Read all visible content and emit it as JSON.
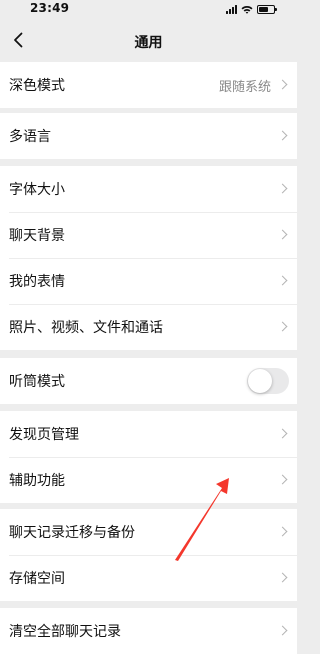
{
  "status_bar": {
    "time": "23:49"
  },
  "header": {
    "title": "通用"
  },
  "groups": [
    {
      "items": [
        {
          "label": "深色模式",
          "value": "跟随系统"
        }
      ]
    },
    {
      "items": [
        {
          "label": "多语言"
        }
      ]
    },
    {
      "items": [
        {
          "label": "字体大小"
        },
        {
          "label": "聊天背景"
        },
        {
          "label": "我的表情"
        },
        {
          "label": "照片、视频、文件和通话"
        }
      ]
    },
    {
      "items": [
        {
          "label": "听筒模式",
          "toggle_on": false
        }
      ]
    },
    {
      "items": [
        {
          "label": "发现页管理"
        },
        {
          "label": "辅助功能"
        }
      ]
    },
    {
      "items": [
        {
          "label": "聊天记录迁移与备份"
        },
        {
          "label": "存储空间"
        }
      ]
    },
    {
      "items": [
        {
          "label": "清空全部聊天记录"
        }
      ]
    }
  ],
  "colors": {
    "page_bg": "#ededed",
    "annotation_arrow": "#f4372c"
  }
}
